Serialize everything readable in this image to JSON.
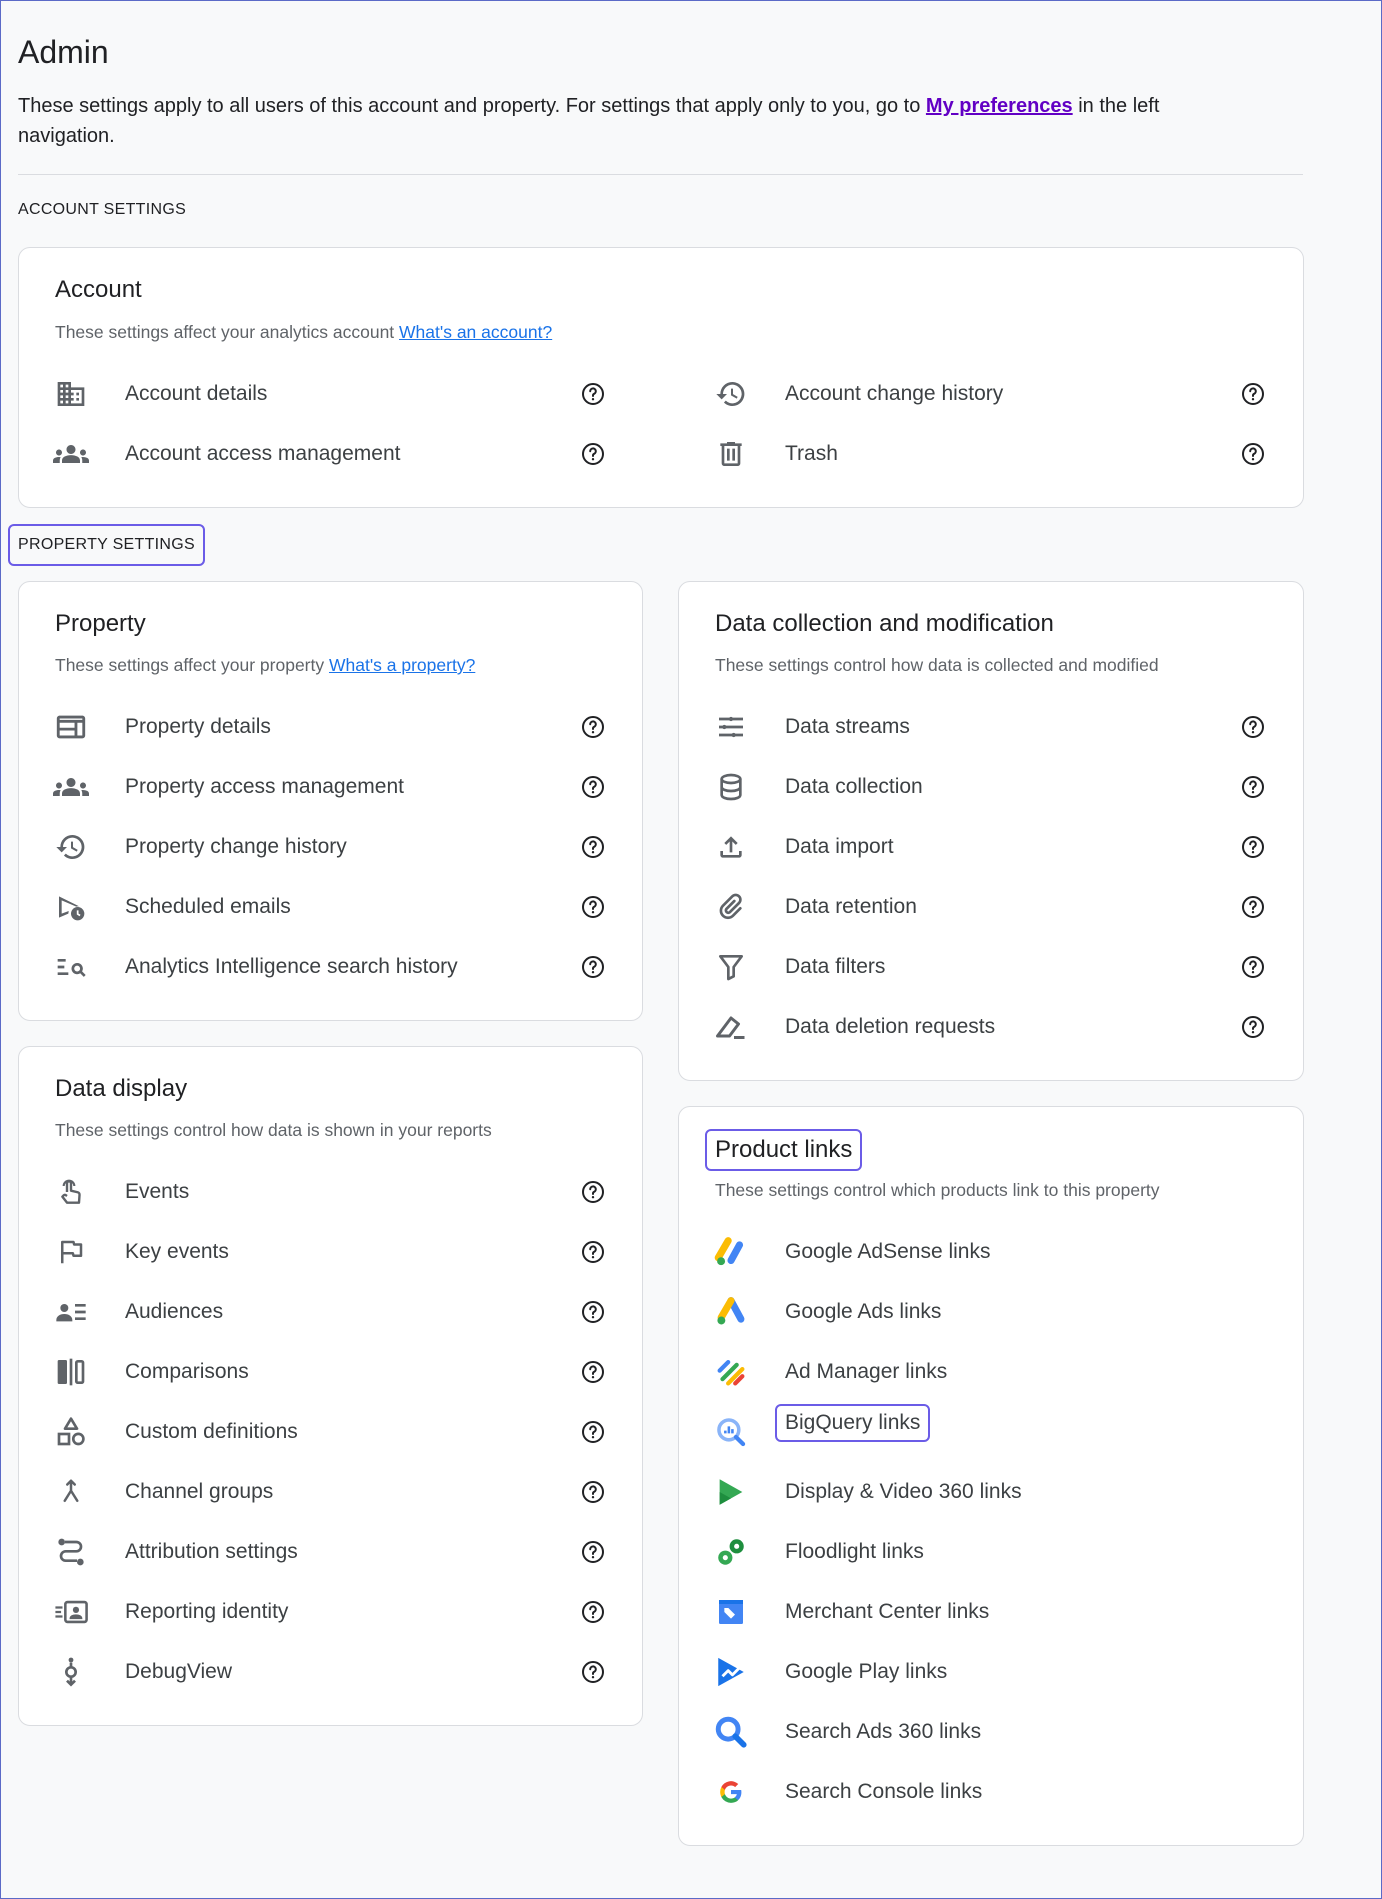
{
  "title": "Admin",
  "intro": {
    "before": "These settings apply to all users of this account and property. For settings that apply only to you, go to ",
    "link": "My preferences",
    "after": " in the left navigation."
  },
  "account_section_label": "ACCOUNT SETTINGS",
  "property_section_label": "PROPERTY SETTINGS",
  "account_card": {
    "title": "Account",
    "desc": "These settings affect your analytics account ",
    "desc_link": "What's an account?",
    "items": [
      {
        "label": "Account details",
        "icon": "building-icon"
      },
      {
        "label": "Account change history",
        "icon": "history-icon"
      },
      {
        "label": "Account access management",
        "icon": "group-icon"
      },
      {
        "label": "Trash",
        "icon": "trash-icon"
      }
    ]
  },
  "property_card": {
    "title": "Property",
    "desc": "These settings affect your property ",
    "desc_link": "What's a property?",
    "items": [
      {
        "label": "Property details",
        "icon": "web-icon"
      },
      {
        "label": "Property access management",
        "icon": "group-icon"
      },
      {
        "label": "Property change history",
        "icon": "history-icon"
      },
      {
        "label": "Scheduled emails",
        "icon": "scheduled-send-icon"
      },
      {
        "label": "Analytics Intelligence search history",
        "icon": "search-list-icon"
      }
    ]
  },
  "data_collection_card": {
    "title": "Data collection and modification",
    "desc": "These settings control how data is collected and modified",
    "items": [
      {
        "label": "Data streams",
        "icon": "streams-icon"
      },
      {
        "label": "Data collection",
        "icon": "database-icon"
      },
      {
        "label": "Data import",
        "icon": "upload-icon"
      },
      {
        "label": "Data retention",
        "icon": "attachment-icon"
      },
      {
        "label": "Data filters",
        "icon": "filter-icon"
      },
      {
        "label": "Data deletion requests",
        "icon": "eraser-icon"
      }
    ]
  },
  "data_display_card": {
    "title": "Data display",
    "desc": "These settings control how data is shown in your reports",
    "items": [
      {
        "label": "Events",
        "icon": "touch-icon"
      },
      {
        "label": "Key events",
        "icon": "flag-icon"
      },
      {
        "label": "Audiences",
        "icon": "audience-icon"
      },
      {
        "label": "Comparisons",
        "icon": "compare-icon"
      },
      {
        "label": "Custom definitions",
        "icon": "shapes-icon"
      },
      {
        "label": "Channel groups",
        "icon": "merge-icon"
      },
      {
        "label": "Attribution settings",
        "icon": "route-icon"
      },
      {
        "label": "Reporting identity",
        "icon": "identity-icon"
      },
      {
        "label": "DebugView",
        "icon": "debug-icon"
      }
    ]
  },
  "product_links_card": {
    "title": "Product links",
    "desc": "These settings control which products link to this property",
    "items": [
      {
        "label": "Google AdSense links",
        "icon": "adsense-icon"
      },
      {
        "label": "Google Ads links",
        "icon": "google-ads-icon"
      },
      {
        "label": "Ad Manager links",
        "icon": "ad-manager-icon"
      },
      {
        "label": "BigQuery links",
        "icon": "bigquery-icon"
      },
      {
        "label": "Display & Video 360 links",
        "icon": "dv360-icon"
      },
      {
        "label": "Floodlight links",
        "icon": "floodlight-icon"
      },
      {
        "label": "Merchant Center links",
        "icon": "merchant-center-icon"
      },
      {
        "label": "Google Play links",
        "icon": "google-play-icon"
      },
      {
        "label": "Search Ads 360 links",
        "icon": "search-ads-360-icon"
      },
      {
        "label": "Search Console links",
        "icon": "google-g-icon"
      }
    ]
  },
  "colors": {
    "icon_gray": "#5f6368",
    "link_blue": "#1a73e8",
    "pref_purple": "#6200c4",
    "highlight_border": "#6b5ce7"
  }
}
